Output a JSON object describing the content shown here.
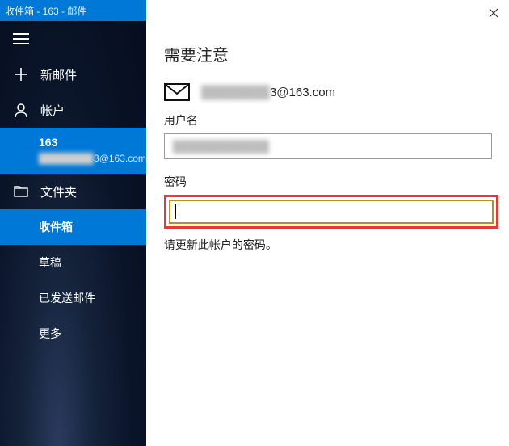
{
  "titlebar": {
    "text": "收件箱 - 163 - 邮件"
  },
  "sidebar": {
    "new_mail_label": "新邮件",
    "accounts_label": "帐户",
    "folders_label": "文件夹",
    "account": {
      "name": "163",
      "email_masked": "████████",
      "email_suffix": "3@163.com"
    },
    "folders": [
      {
        "label": "收件箱",
        "active": true
      },
      {
        "label": "草稿",
        "active": false
      },
      {
        "label": "已发送邮件",
        "active": false
      },
      {
        "label": "更多",
        "active": false
      }
    ]
  },
  "panel": {
    "title": "需要注意",
    "email_masked": "████████",
    "email_suffix": "3@163.com",
    "username_label": "用户名",
    "username_value_masked": "████████████",
    "password_label": "密码",
    "password_value": "",
    "hint": "请更新此帐户的密码。"
  }
}
